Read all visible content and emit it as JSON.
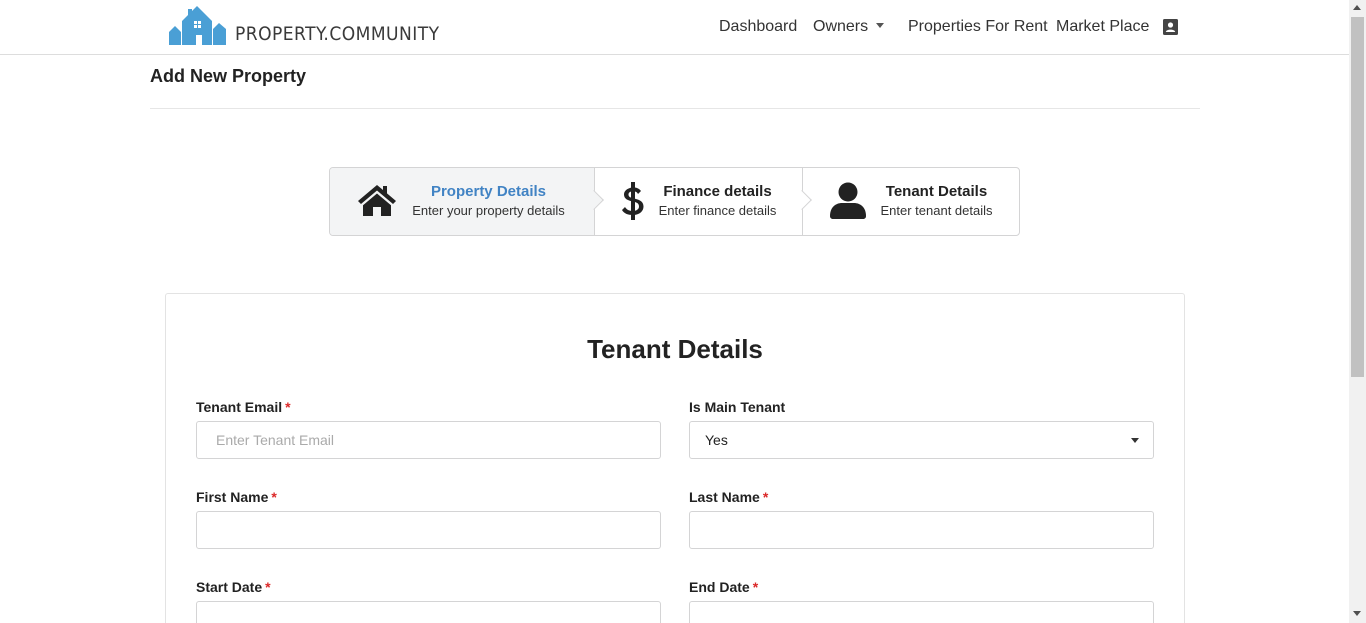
{
  "brand": {
    "logo_text": "PROPERTY.COMMUNITY",
    "logo_color": "#4a9fd5"
  },
  "nav": {
    "items": [
      {
        "label": "Dashboard"
      },
      {
        "label": "Owners"
      },
      {
        "label": "Properties For Rent"
      },
      {
        "label": "Market Place"
      }
    ],
    "contact_icon": "contact-card-icon"
  },
  "page": {
    "title": "Add New Property"
  },
  "stepper": {
    "active_color": "#4183c4",
    "steps": [
      {
        "title": "Property Details",
        "description": "Enter your property details",
        "icon": "home-icon",
        "active": true
      },
      {
        "title": "Finance details",
        "description": "Enter finance details",
        "icon": "dollar-icon",
        "active": false
      },
      {
        "title": "Tenant Details",
        "description": "Enter tenant details",
        "icon": "user-icon",
        "active": false
      }
    ]
  },
  "form": {
    "title": "Tenant Details",
    "required_marker": "*",
    "fields": {
      "tenant_email": {
        "label": "Tenant Email",
        "placeholder": "Enter Tenant Email",
        "value": ""
      },
      "is_main_tenant": {
        "label": "Is Main Tenant",
        "value": "Yes"
      },
      "first_name": {
        "label": "First Name",
        "value": ""
      },
      "last_name": {
        "label": "Last Name",
        "value": ""
      },
      "start_date": {
        "label": "Start Date",
        "value": ""
      },
      "end_date": {
        "label": "End Date",
        "value": ""
      }
    }
  }
}
